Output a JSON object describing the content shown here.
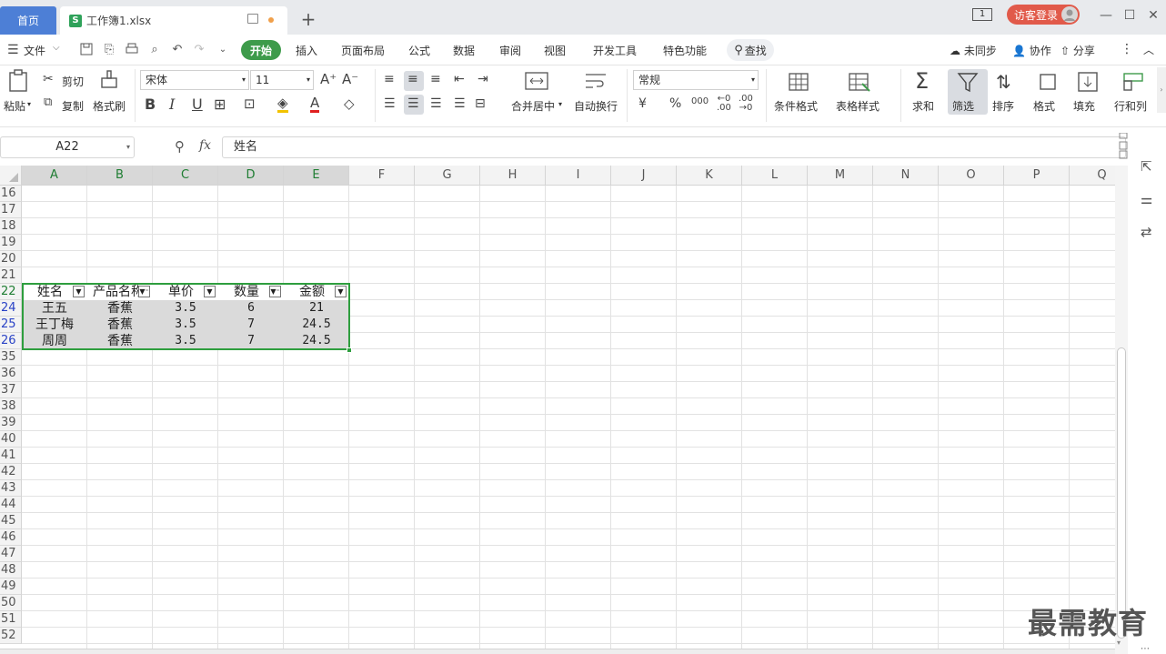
{
  "titlebar": {
    "home_tab": "首页",
    "file_tab": "工作簿1.xlsx",
    "file_logo": "S",
    "login": "访客登录",
    "window_badge": "1"
  },
  "menubar": {
    "file_menu": "文件",
    "items": [
      "开始",
      "插入",
      "页面布局",
      "公式",
      "数据",
      "审阅",
      "视图",
      "开发工具",
      "特色功能"
    ],
    "search": "查找",
    "sync": "未同步",
    "collab": "协作",
    "share": "分享"
  },
  "ribbon": {
    "paste": "粘贴",
    "cut": "剪切",
    "copy": "复制",
    "format_painter": "格式刷",
    "font_name": "宋体",
    "font_size": "11",
    "number_format": "常规",
    "merge_center": "合并居中",
    "wrap_text": "自动换行",
    "cond_format": "条件格式",
    "table_style": "表格样式",
    "sum": "求和",
    "filter": "筛选",
    "sort": "排序",
    "format": "格式",
    "fill": "填充",
    "rows_cols": "行和列",
    "currency": "¥",
    "percent": "%",
    "thousands": "000"
  },
  "formula_bar": {
    "name_box": "A22",
    "fx": "fx",
    "value": "姓名"
  },
  "grid": {
    "columns": [
      "A",
      "B",
      "C",
      "D",
      "E",
      "F",
      "G",
      "H",
      "I",
      "J",
      "K",
      "L",
      "M",
      "N",
      "O",
      "P",
      "Q"
    ],
    "rows": [
      "16",
      "17",
      "18",
      "19",
      "20",
      "21",
      "22",
      "24",
      "25",
      "26",
      "35",
      "36",
      "37",
      "38",
      "39",
      "40",
      "41",
      "42",
      "43",
      "44",
      "45",
      "46",
      "47",
      "48",
      "49",
      "50",
      "51",
      "52"
    ],
    "table": {
      "headers": [
        "姓名",
        "产品名称",
        "单价",
        "数量",
        "金额"
      ],
      "rows": [
        [
          "王五",
          "香蕉",
          "3.5",
          "6",
          "21"
        ],
        [
          "王丁梅",
          "香蕉",
          "3.5",
          "7",
          "24.5"
        ],
        [
          "周周",
          "香蕉",
          "3.5",
          "7",
          "24.5"
        ]
      ]
    }
  },
  "watermark": "最需教育",
  "colors": {
    "accent_green": "#3e9b4b",
    "selection_green": "#2e9e3e",
    "home_tab_blue": "#4d7fd6",
    "login_red": "#e15a4a",
    "filtered_row_blue": "#2a43c6"
  }
}
